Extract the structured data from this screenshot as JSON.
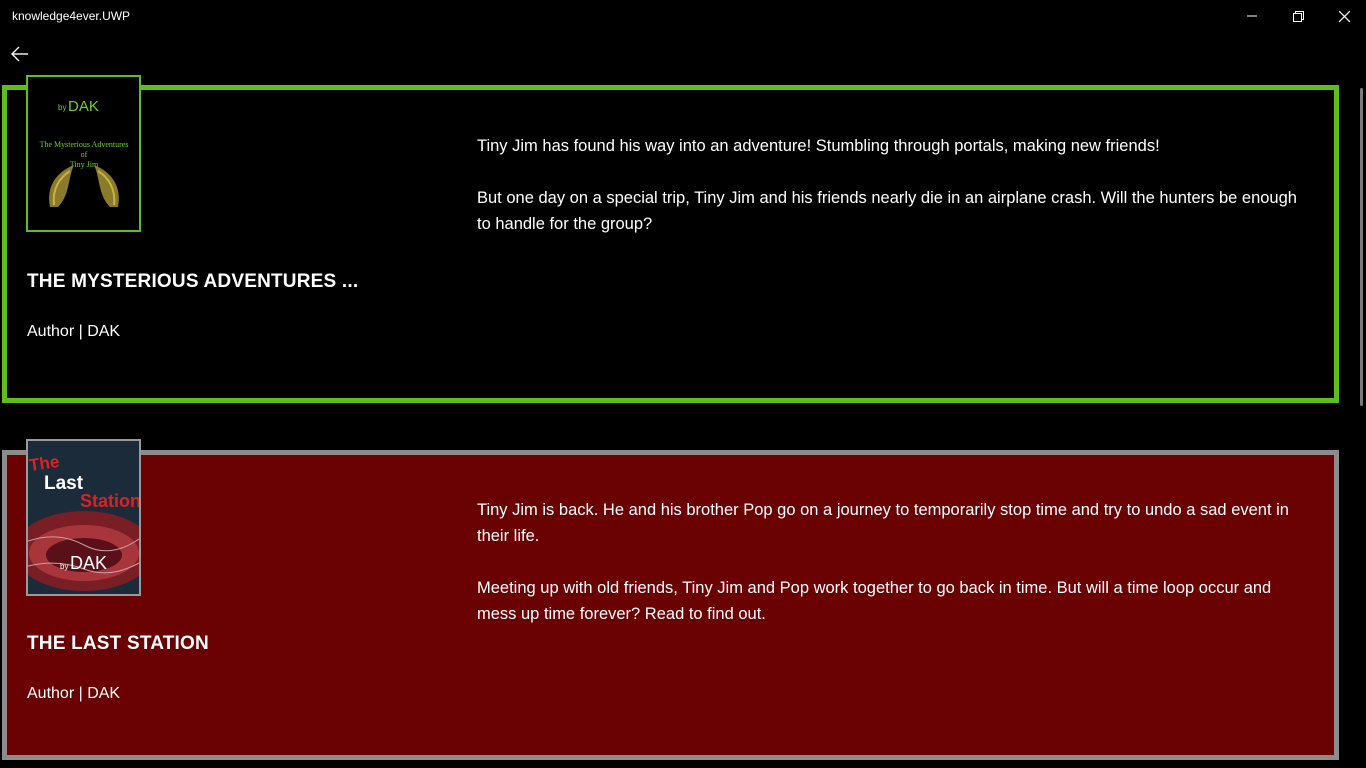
{
  "window": {
    "title": "knowledge4ever.UWP",
    "minimize_glyph": "—",
    "maximize_glyph": "❐",
    "close_glyph": "✕"
  },
  "nav": {
    "back_icon": "back-arrow-icon"
  },
  "books": [
    {
      "title": "THE MYSTERIOUS ADVENTURES ...",
      "author": "Author | DAK",
      "description": [
        "Tiny Jim has found his way into an adventure! Stumbling through portals, making new friends!",
        "But one day on a special trip, Tiny Jim and his friends nearly die in an airplane crash. Will the hunters be enough to handle for the group?"
      ],
      "cover": {
        "by": "by",
        "author": "DAK",
        "title_line1": "The Mysterious Adventures",
        "title_line2": "of",
        "title_line3": "Tiny Jim"
      },
      "border_color": "#5fbd1c",
      "background": "#000000"
    },
    {
      "title": "THE LAST STATION",
      "author": "Author | DAK",
      "description": [
        "Tiny Jim is back. He and his brother Pop go on a journey to temporarily stop time and try to undo a sad event in their life.",
        "Meeting up with old friends, Tiny Jim and Pop work together to go back in time. But will a time loop occur and mess up time forever? Read to find out."
      ],
      "cover": {
        "title_the": "The",
        "title_last": "Last",
        "title_station": "Station",
        "by": "by",
        "author": "DAK"
      },
      "border_color": "#8c8c8c",
      "background": "#6a0203"
    }
  ]
}
